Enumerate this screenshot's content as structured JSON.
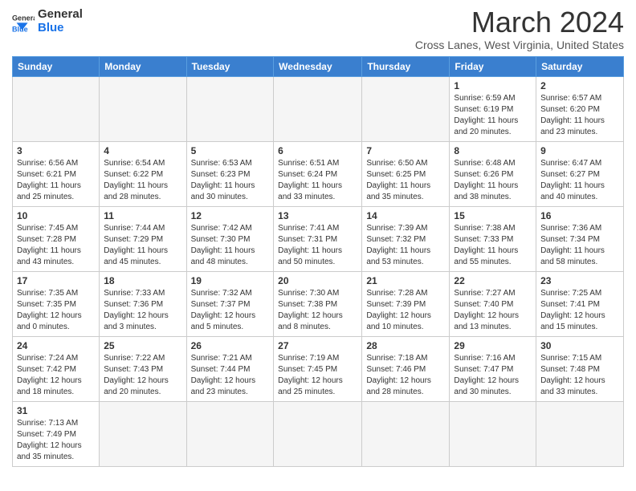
{
  "logo": {
    "text_general": "General",
    "text_blue": "Blue"
  },
  "header": {
    "month_year": "March 2024",
    "location": "Cross Lanes, West Virginia, United States"
  },
  "days_of_week": [
    "Sunday",
    "Monday",
    "Tuesday",
    "Wednesday",
    "Thursday",
    "Friday",
    "Saturday"
  ],
  "weeks": [
    [
      {
        "day": "",
        "info": ""
      },
      {
        "day": "",
        "info": ""
      },
      {
        "day": "",
        "info": ""
      },
      {
        "day": "",
        "info": ""
      },
      {
        "day": "",
        "info": ""
      },
      {
        "day": "1",
        "info": "Sunrise: 6:59 AM\nSunset: 6:19 PM\nDaylight: 11 hours and 20 minutes."
      },
      {
        "day": "2",
        "info": "Sunrise: 6:57 AM\nSunset: 6:20 PM\nDaylight: 11 hours and 23 minutes."
      }
    ],
    [
      {
        "day": "3",
        "info": "Sunrise: 6:56 AM\nSunset: 6:21 PM\nDaylight: 11 hours and 25 minutes."
      },
      {
        "day": "4",
        "info": "Sunrise: 6:54 AM\nSunset: 6:22 PM\nDaylight: 11 hours and 28 minutes."
      },
      {
        "day": "5",
        "info": "Sunrise: 6:53 AM\nSunset: 6:23 PM\nDaylight: 11 hours and 30 minutes."
      },
      {
        "day": "6",
        "info": "Sunrise: 6:51 AM\nSunset: 6:24 PM\nDaylight: 11 hours and 33 minutes."
      },
      {
        "day": "7",
        "info": "Sunrise: 6:50 AM\nSunset: 6:25 PM\nDaylight: 11 hours and 35 minutes."
      },
      {
        "day": "8",
        "info": "Sunrise: 6:48 AM\nSunset: 6:26 PM\nDaylight: 11 hours and 38 minutes."
      },
      {
        "day": "9",
        "info": "Sunrise: 6:47 AM\nSunset: 6:27 PM\nDaylight: 11 hours and 40 minutes."
      }
    ],
    [
      {
        "day": "10",
        "info": "Sunrise: 7:45 AM\nSunset: 7:28 PM\nDaylight: 11 hours and 43 minutes."
      },
      {
        "day": "11",
        "info": "Sunrise: 7:44 AM\nSunset: 7:29 PM\nDaylight: 11 hours and 45 minutes."
      },
      {
        "day": "12",
        "info": "Sunrise: 7:42 AM\nSunset: 7:30 PM\nDaylight: 11 hours and 48 minutes."
      },
      {
        "day": "13",
        "info": "Sunrise: 7:41 AM\nSunset: 7:31 PM\nDaylight: 11 hours and 50 minutes."
      },
      {
        "day": "14",
        "info": "Sunrise: 7:39 AM\nSunset: 7:32 PM\nDaylight: 11 hours and 53 minutes."
      },
      {
        "day": "15",
        "info": "Sunrise: 7:38 AM\nSunset: 7:33 PM\nDaylight: 11 hours and 55 minutes."
      },
      {
        "day": "16",
        "info": "Sunrise: 7:36 AM\nSunset: 7:34 PM\nDaylight: 11 hours and 58 minutes."
      }
    ],
    [
      {
        "day": "17",
        "info": "Sunrise: 7:35 AM\nSunset: 7:35 PM\nDaylight: 12 hours and 0 minutes."
      },
      {
        "day": "18",
        "info": "Sunrise: 7:33 AM\nSunset: 7:36 PM\nDaylight: 12 hours and 3 minutes."
      },
      {
        "day": "19",
        "info": "Sunrise: 7:32 AM\nSunset: 7:37 PM\nDaylight: 12 hours and 5 minutes."
      },
      {
        "day": "20",
        "info": "Sunrise: 7:30 AM\nSunset: 7:38 PM\nDaylight: 12 hours and 8 minutes."
      },
      {
        "day": "21",
        "info": "Sunrise: 7:28 AM\nSunset: 7:39 PM\nDaylight: 12 hours and 10 minutes."
      },
      {
        "day": "22",
        "info": "Sunrise: 7:27 AM\nSunset: 7:40 PM\nDaylight: 12 hours and 13 minutes."
      },
      {
        "day": "23",
        "info": "Sunrise: 7:25 AM\nSunset: 7:41 PM\nDaylight: 12 hours and 15 minutes."
      }
    ],
    [
      {
        "day": "24",
        "info": "Sunrise: 7:24 AM\nSunset: 7:42 PM\nDaylight: 12 hours and 18 minutes."
      },
      {
        "day": "25",
        "info": "Sunrise: 7:22 AM\nSunset: 7:43 PM\nDaylight: 12 hours and 20 minutes."
      },
      {
        "day": "26",
        "info": "Sunrise: 7:21 AM\nSunset: 7:44 PM\nDaylight: 12 hours and 23 minutes."
      },
      {
        "day": "27",
        "info": "Sunrise: 7:19 AM\nSunset: 7:45 PM\nDaylight: 12 hours and 25 minutes."
      },
      {
        "day": "28",
        "info": "Sunrise: 7:18 AM\nSunset: 7:46 PM\nDaylight: 12 hours and 28 minutes."
      },
      {
        "day": "29",
        "info": "Sunrise: 7:16 AM\nSunset: 7:47 PM\nDaylight: 12 hours and 30 minutes."
      },
      {
        "day": "30",
        "info": "Sunrise: 7:15 AM\nSunset: 7:48 PM\nDaylight: 12 hours and 33 minutes."
      }
    ],
    [
      {
        "day": "31",
        "info": "Sunrise: 7:13 AM\nSunset: 7:49 PM\nDaylight: 12 hours and 35 minutes."
      },
      {
        "day": "",
        "info": ""
      },
      {
        "day": "",
        "info": ""
      },
      {
        "day": "",
        "info": ""
      },
      {
        "day": "",
        "info": ""
      },
      {
        "day": "",
        "info": ""
      },
      {
        "day": "",
        "info": ""
      }
    ]
  ]
}
